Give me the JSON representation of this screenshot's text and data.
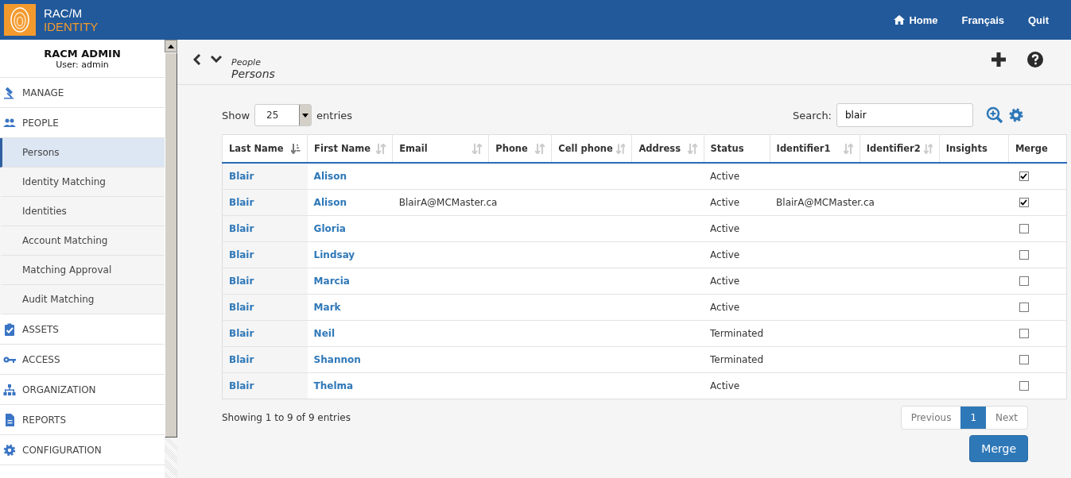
{
  "header": {
    "logo_line1": "RAC/M",
    "logo_line2": "IDENTITY",
    "nav": [
      {
        "label": "Home",
        "kind": "home"
      },
      {
        "label": "Français",
        "kind": "text"
      },
      {
        "label": "Quit",
        "kind": "text"
      }
    ]
  },
  "sidebar": {
    "title": "RACM ADMIN",
    "user": "User: admin",
    "items": [
      {
        "label": "MANAGE",
        "kind": "gavel"
      },
      {
        "label": "PEOPLE",
        "kind": "people",
        "children": [
          {
            "label": "Persons",
            "selected": true
          },
          {
            "label": "Identity Matching",
            "selected": false
          },
          {
            "label": "Identities",
            "selected": false
          },
          {
            "label": "Account Matching",
            "selected": false
          },
          {
            "label": "Matching Approval",
            "selected": false
          },
          {
            "label": "Audit Matching",
            "selected": false
          }
        ]
      },
      {
        "label": "ASSETS",
        "kind": "clipboard"
      },
      {
        "label": "ACCESS",
        "kind": "key"
      },
      {
        "label": "ORGANIZATION",
        "kind": "org"
      },
      {
        "label": "REPORTS",
        "kind": "document"
      },
      {
        "label": "CONFIGURATION",
        "kind": "gear"
      }
    ]
  },
  "page": {
    "breadcrumb": "People",
    "title": "Persons"
  },
  "table_controls": {
    "show_label": "Show",
    "page_size": "25",
    "entries_label": "entries",
    "search_label": "Search:",
    "search_value": "blair"
  },
  "table": {
    "columns": [
      {
        "label": "Last Name",
        "sortable": true,
        "sorted": true
      },
      {
        "label": "First Name",
        "sortable": true,
        "sorted": false
      },
      {
        "label": "Email",
        "sortable": true,
        "sorted": false
      },
      {
        "label": "Phone",
        "sortable": true,
        "sorted": false
      },
      {
        "label": "Cell phone",
        "sortable": true,
        "sorted": false
      },
      {
        "label": "Address",
        "sortable": true,
        "sorted": false
      },
      {
        "label": "Status",
        "sortable": false
      },
      {
        "label": "Identifier1",
        "sortable": true,
        "sorted": false
      },
      {
        "label": "Identifier2",
        "sortable": true,
        "sorted": false
      },
      {
        "label": "Insights",
        "sortable": false
      },
      {
        "label": "Merge",
        "sortable": false
      }
    ],
    "rows": [
      {
        "last_name": "Blair",
        "first_name": "Alison",
        "status": "Active",
        "merge": true
      },
      {
        "last_name": "Blair",
        "first_name": "Alison",
        "email": "BlairA@MCMaster.ca",
        "status": "Active",
        "identifier1": "BlairA@MCMaster.ca",
        "merge": true
      },
      {
        "last_name": "Blair",
        "first_name": "Gloria",
        "status": "Active",
        "merge": false
      },
      {
        "last_name": "Blair",
        "first_name": "Lindsay",
        "status": "Active",
        "merge": false
      },
      {
        "last_name": "Blair",
        "first_name": "Marcia",
        "status": "Active",
        "merge": false
      },
      {
        "last_name": "Blair",
        "first_name": "Mark",
        "status": "Active",
        "merge": false
      },
      {
        "last_name": "Blair",
        "first_name": "Neil",
        "status": "Terminated",
        "merge": false
      },
      {
        "last_name": "Blair",
        "first_name": "Shannon",
        "status": "Terminated",
        "merge": false
      },
      {
        "last_name": "Blair",
        "first_name": "Thelma",
        "status": "Active",
        "merge": false
      }
    ]
  },
  "footer": {
    "info": "Showing 1 to 9 of 9 entries",
    "pagination": [
      {
        "label": "Previous",
        "selected": false
      },
      {
        "label": "1",
        "selected": true
      },
      {
        "label": "Next",
        "selected": false
      }
    ],
    "merge_button": "Merge"
  }
}
